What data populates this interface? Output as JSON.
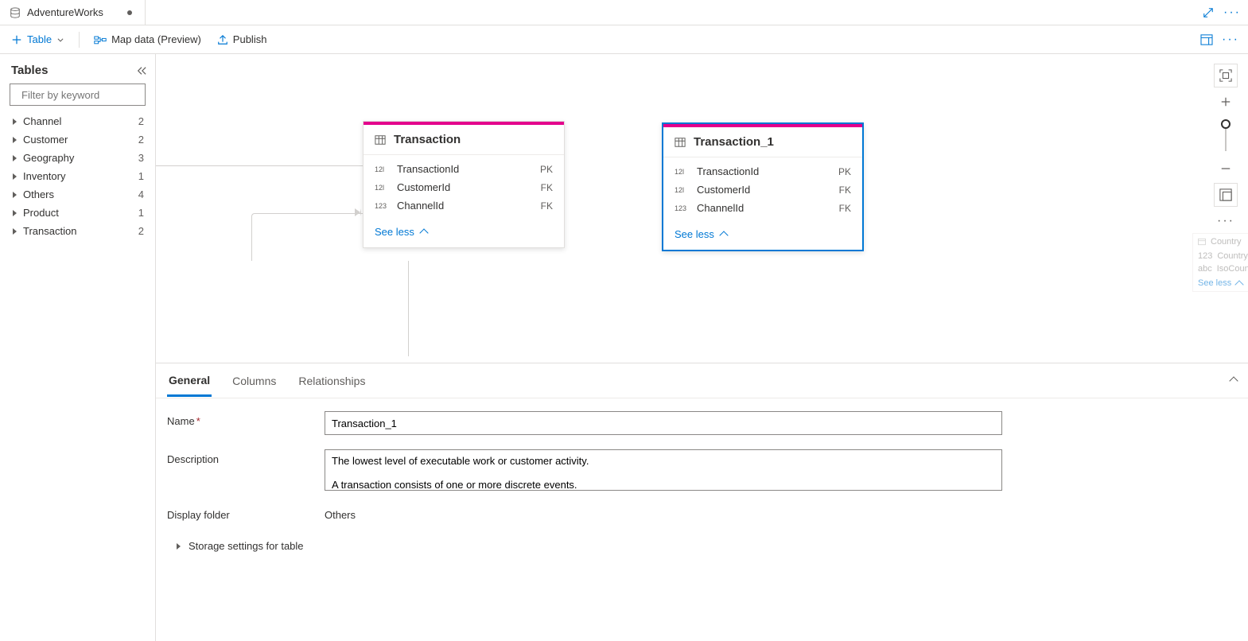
{
  "titlebar": {
    "tab_label": "AdventureWorks"
  },
  "toolbar": {
    "table_label": "Table",
    "map_data_label": "Map data (Preview)",
    "publish_label": "Publish"
  },
  "sidebar": {
    "title": "Tables",
    "filter_placeholder": "Filter by keyword",
    "items": [
      {
        "label": "Channel",
        "count": "2"
      },
      {
        "label": "Customer",
        "count": "2"
      },
      {
        "label": "Geography",
        "count": "3"
      },
      {
        "label": "Inventory",
        "count": "1"
      },
      {
        "label": "Others",
        "count": "4"
      },
      {
        "label": "Product",
        "count": "1"
      },
      {
        "label": "Transaction",
        "count": "2"
      }
    ]
  },
  "canvas": {
    "card1": {
      "title": "Transaction",
      "rows": [
        {
          "type": "12l",
          "name": "TransactionId",
          "key": "PK"
        },
        {
          "type": "12l",
          "name": "CustomerId",
          "key": "FK"
        },
        {
          "type": "123",
          "name": "ChannelId",
          "key": "FK"
        }
      ],
      "see_less": "See less"
    },
    "card2": {
      "title": "Transaction_1",
      "rows": [
        {
          "type": "12l",
          "name": "TransactionId",
          "key": "PK"
        },
        {
          "type": "12l",
          "name": "CustomerId",
          "key": "FK"
        },
        {
          "type": "123",
          "name": "ChannelId",
          "key": "FK"
        }
      ],
      "see_less": "See less"
    },
    "peek": {
      "title": "Country",
      "rows": [
        {
          "type": "123",
          "name": "CountryId"
        },
        {
          "type": "abc",
          "name": "IsoCountry"
        }
      ],
      "see_less": "See less"
    }
  },
  "props": {
    "tabs": {
      "general": "General",
      "columns": "Columns",
      "relationships": "Relationships"
    },
    "name_label": "Name",
    "name_value": "Transaction_1",
    "description_label": "Description",
    "description_value": "The lowest level of executable work or customer activity.\n\nA transaction consists of one or more discrete events.",
    "display_folder_label": "Display folder",
    "display_folder_value": "Others",
    "storage_label": "Storage settings for table"
  }
}
